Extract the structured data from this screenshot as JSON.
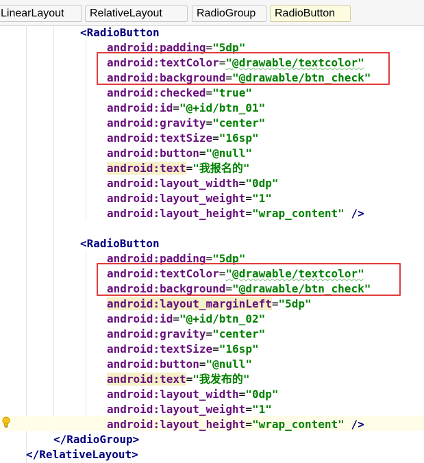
{
  "tabs": [
    {
      "label": "LinearLayout",
      "active": false
    },
    {
      "label": "RelativeLayout",
      "active": false
    },
    {
      "label": "RadioGroup",
      "active": false
    },
    {
      "label": "RadioButton",
      "active": true
    }
  ],
  "colors": {
    "highlight_box": "#e23b3b",
    "tag": "#000080",
    "attribute": "#660e7a",
    "value": "#008000"
  },
  "code": {
    "rb1_open": "<RadioButton",
    "rb1": {
      "padding": {
        "ns": "android",
        "name": "padding",
        "value": "\"5dp\""
      },
      "textColor": {
        "ns": "android",
        "name": "textColor",
        "value": "\"@drawable/textcolor\""
      },
      "background": {
        "ns": "android",
        "name": "background",
        "value": "\"@drawable/btn_check\""
      },
      "checked": {
        "ns": "android",
        "name": "checked",
        "value": "\"true\""
      },
      "id": {
        "ns": "android",
        "name": "id",
        "value": "\"@+id/btn_01\""
      },
      "gravity": {
        "ns": "android",
        "name": "gravity",
        "value": "\"center\""
      },
      "textSize": {
        "ns": "android",
        "name": "textSize",
        "value": "\"16sp\""
      },
      "button": {
        "ns": "android",
        "name": "button",
        "value": "\"@null\""
      },
      "text": {
        "ns": "android",
        "name": "text",
        "value": "\"我报名的\""
      },
      "layout_width": {
        "ns": "android",
        "name": "layout_width",
        "value": "\"0dp\""
      },
      "layout_weight": {
        "ns": "android",
        "name": "layout_weight",
        "value": "\"1\""
      },
      "layout_height": {
        "ns": "android",
        "name": "layout_height",
        "value": "\"wrap_content\""
      }
    },
    "rb2_open": "<RadioButton",
    "rb2": {
      "padding": {
        "ns": "android",
        "name": "padding",
        "value": "\"5dp\""
      },
      "textColor": {
        "ns": "android",
        "name": "textColor",
        "value": "\"@drawable/textcolor\""
      },
      "background": {
        "ns": "android",
        "name": "background",
        "value": "\"@drawable/btn_check\""
      },
      "layout_marginLeft": {
        "ns": "android",
        "name": "layout_marginLeft",
        "value": "\"5dp\""
      },
      "id": {
        "ns": "android",
        "name": "id",
        "value": "\"@+id/btn_02\""
      },
      "gravity": {
        "ns": "android",
        "name": "gravity",
        "value": "\"center\""
      },
      "textSize": {
        "ns": "android",
        "name": "textSize",
        "value": "\"16sp\""
      },
      "button": {
        "ns": "android",
        "name": "button",
        "value": "\"@null\""
      },
      "text": {
        "ns": "android",
        "name": "text",
        "value": "\"我发布的\""
      },
      "layout_width": {
        "ns": "android",
        "name": "layout_width",
        "value": "\"0dp\""
      },
      "layout_weight": {
        "ns": "android",
        "name": "layout_weight",
        "value": "\"1\""
      },
      "layout_height": {
        "ns": "android",
        "name": "layout_height",
        "value": "\"wrap_content\""
      }
    },
    "self_close": " />",
    "close_radiogroup": "</RadioGroup>",
    "close_relativelayout": "</RelativeLayout>"
  }
}
